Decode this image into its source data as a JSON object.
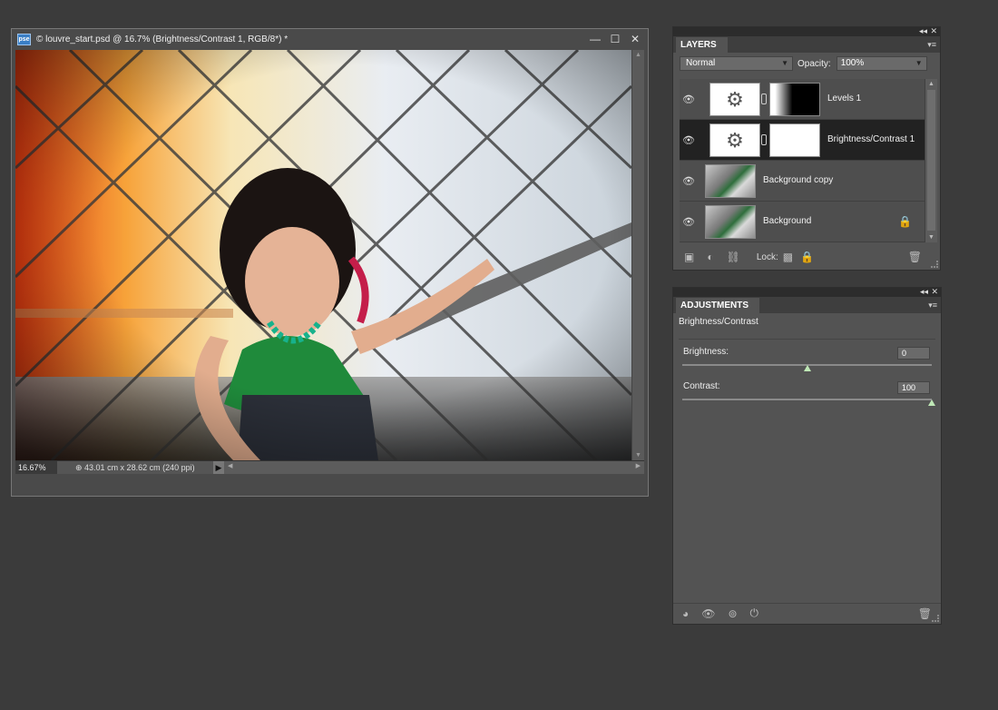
{
  "document": {
    "title": "© louvre_start.psd @ 16.7% (Brightness/Contrast 1, RGB/8*) *",
    "app_badge": "pse",
    "zoom": "16.67%",
    "doc_size": "⊕ 43.01 cm x 28.62 cm (240 ppi)",
    "controls": {
      "minimize": "—",
      "maximize": "☐",
      "close": "✕"
    }
  },
  "layers_panel": {
    "tab": "LAYERS",
    "blend_mode": "Normal",
    "opacity_label": "Opacity:",
    "opacity_value": "100%",
    "lock_label": "Lock:",
    "layers": [
      {
        "name": "Levels 1",
        "type": "adjustment",
        "mask": "gradient",
        "visible": true,
        "selected": false
      },
      {
        "name": "Brightness/Contrast 1",
        "type": "adjustment",
        "mask": "white",
        "visible": true,
        "selected": true
      },
      {
        "name": "Background copy",
        "type": "photo",
        "visible": true,
        "selected": false
      },
      {
        "name": "Background",
        "type": "photo",
        "visible": true,
        "selected": false,
        "locked": true
      }
    ]
  },
  "adjustments_panel": {
    "tab": "ADJUSTMENTS",
    "title": "Brightness/Contrast",
    "brightness": {
      "label": "Brightness:",
      "value": "0",
      "level": 0.5
    },
    "contrast": {
      "label": "Contrast:",
      "value": "100",
      "level": 1.0
    }
  },
  "colors": {
    "app_bg": "#3b3b3b",
    "panel_bg": "#535353",
    "selected_row": "#222222",
    "slider_knob": "#bfe8b6"
  }
}
